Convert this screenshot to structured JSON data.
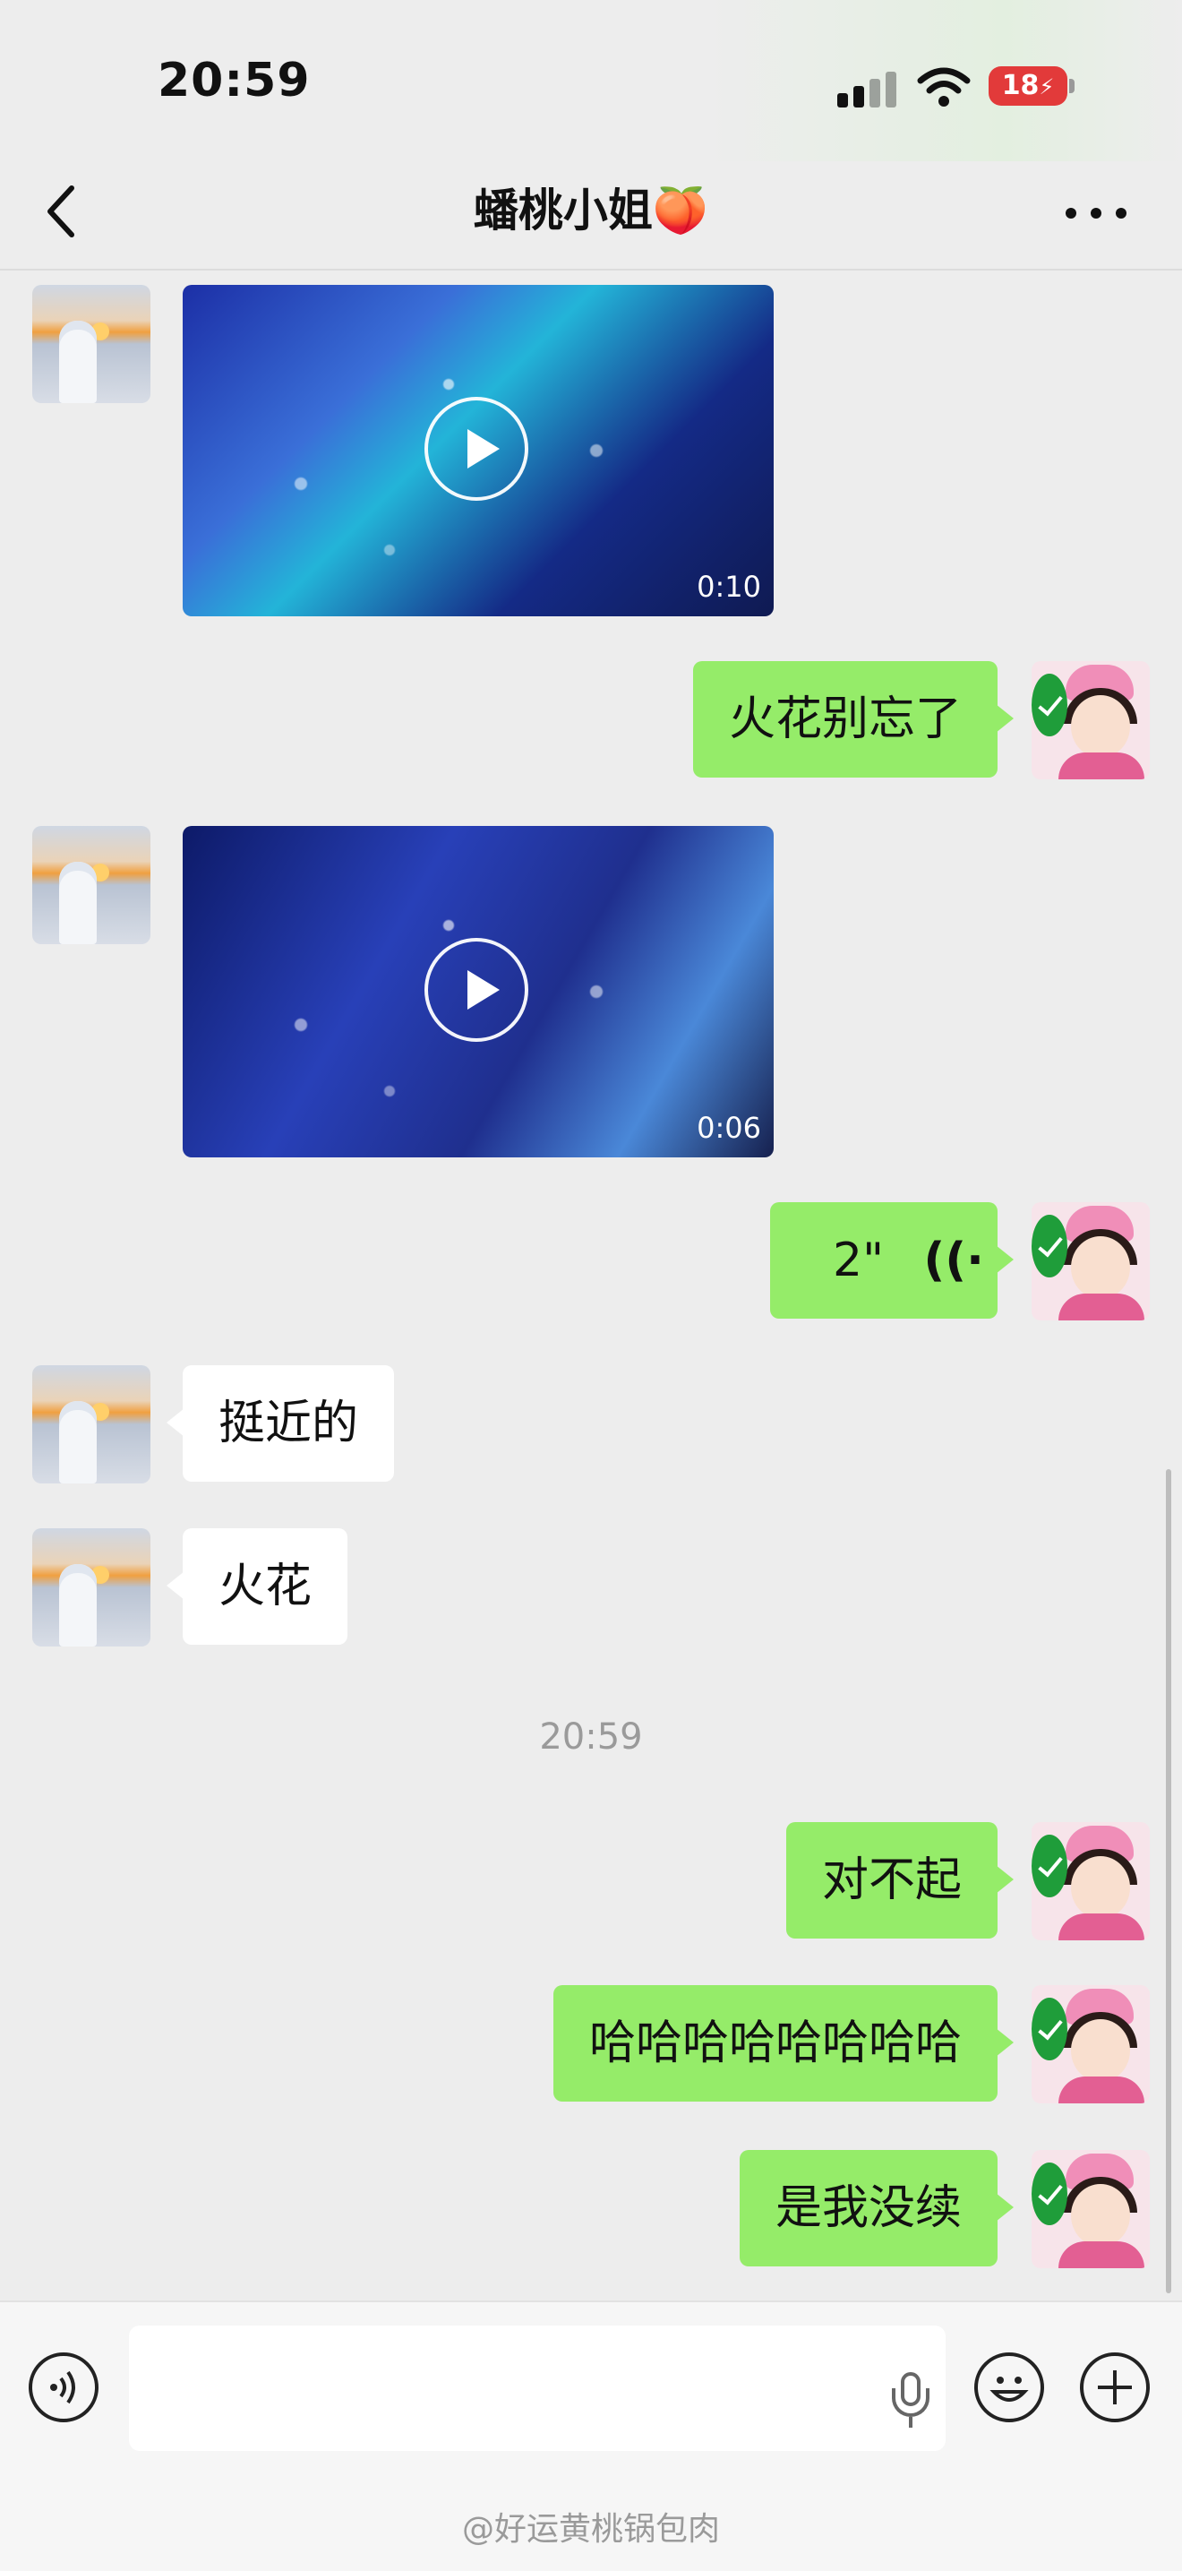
{
  "status_bar": {
    "time": "20:59",
    "battery": "18"
  },
  "header": {
    "title": "蟠桃小姐🍑"
  },
  "messages": {
    "video_1_duration": "0:10",
    "sent_1": "火花别忘了",
    "video_2_duration": "0:06",
    "voice_duration": "2\"",
    "received_1": "挺近的",
    "received_2": "火花",
    "timestamp": "20:59",
    "sent_2": "对不起",
    "sent_3": "哈哈哈哈哈哈哈哈",
    "sent_4": "是我没续"
  },
  "watermark": "@好运黄桃锅包肉",
  "colors": {
    "sent_bubble": "#95ec69",
    "received_bubble": "#ffffff",
    "background": "#ededed",
    "battery_low": "#e23a3a"
  }
}
